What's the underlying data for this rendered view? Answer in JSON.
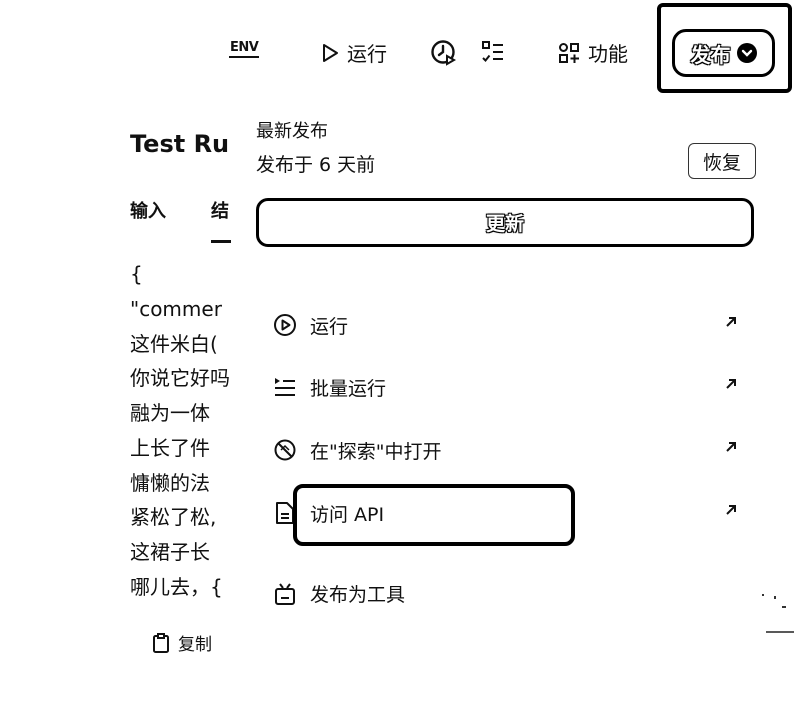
{
  "toolbar": {
    "env_label": "ENV",
    "run_label": "运行",
    "feature_label": "功能",
    "publish_label": "发布"
  },
  "left_panel": {
    "title": "Test Ru",
    "tabs": [
      "输入",
      "结"
    ],
    "lines": [
      "{",
      "\"commer",
      "这件米白(",
      "你说它好吗",
      "融为一体",
      "上长了件",
      "慵懒的法",
      "紧松了松,",
      "这裙子长",
      "哪儿去，{"
    ],
    "copy_label": "复制"
  },
  "publish_menu": {
    "latest_label": "最新发布",
    "published_ago": "发布于 6 天前",
    "restore_label": "恢复",
    "update_label": "更新",
    "items": [
      {
        "label": "运行",
        "icon": "play-circle-icon"
      },
      {
        "label": "批量运行",
        "icon": "batch-list-icon"
      },
      {
        "label": "在\"探索\"中打开",
        "icon": "compass-icon"
      },
      {
        "label": "访问 API",
        "icon": "document-icon"
      }
    ],
    "tool_label": "发布为工具"
  }
}
